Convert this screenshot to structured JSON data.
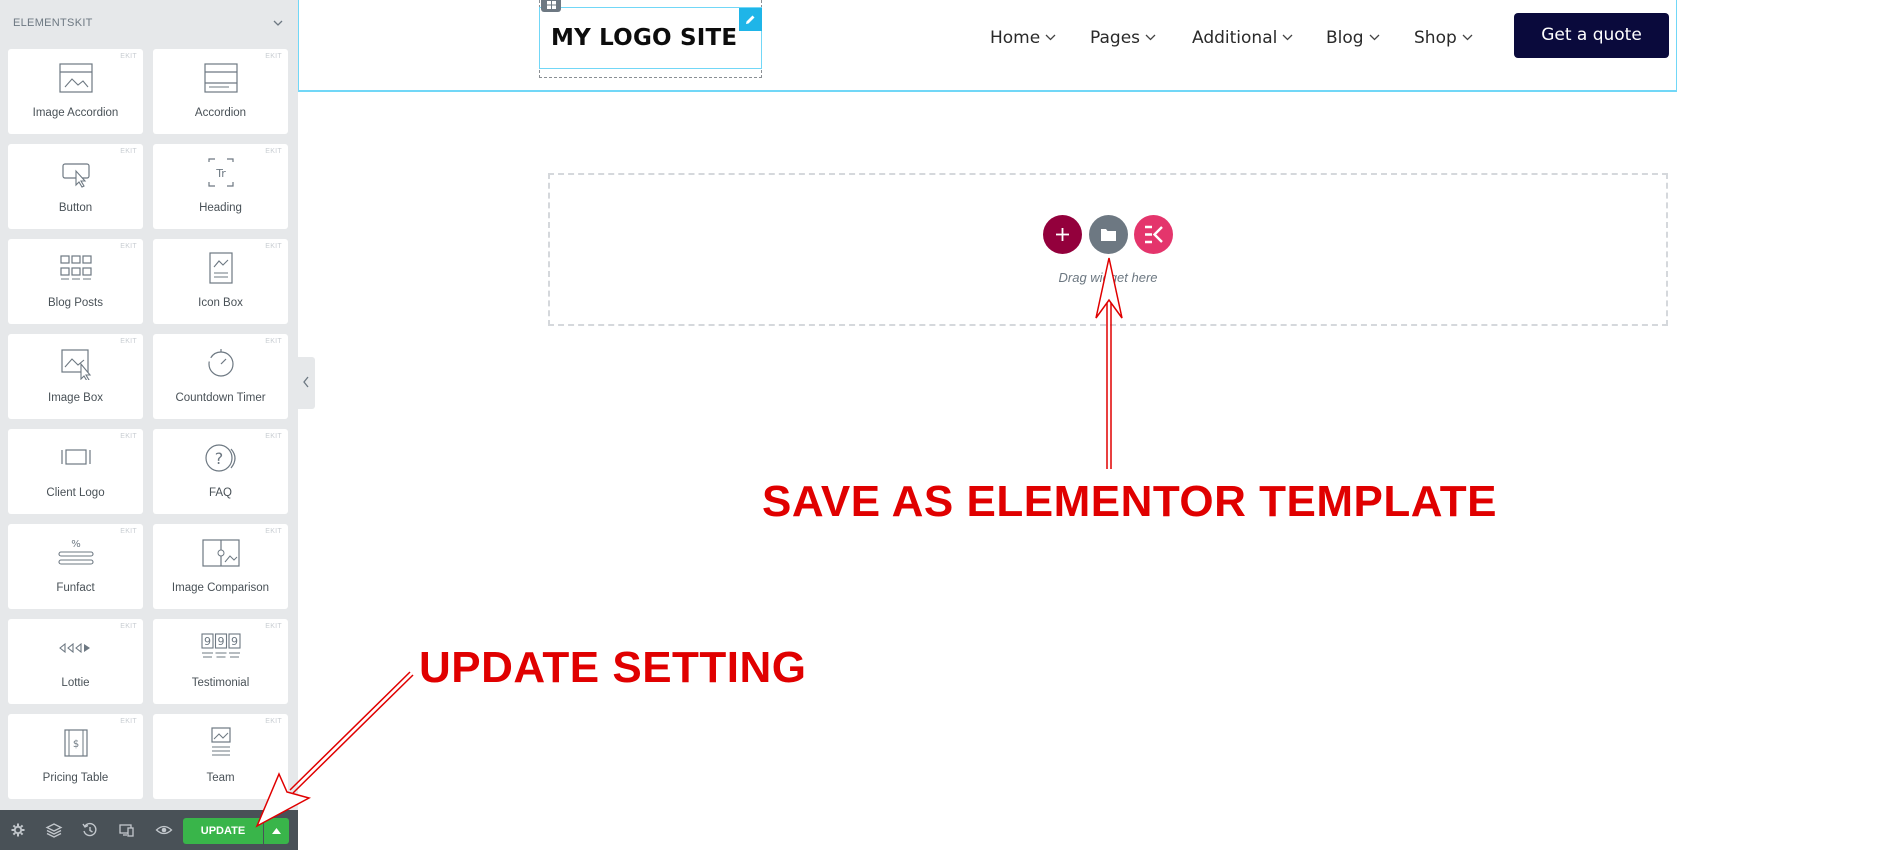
{
  "sidebar": {
    "title": "ELEMENTSKIT",
    "widgets": [
      {
        "label": "Image Accordion",
        "badge": "EKIT",
        "icon": "image-accordion-icon"
      },
      {
        "label": "Accordion",
        "badge": "EKIT",
        "icon": "accordion-icon"
      },
      {
        "label": "Button",
        "badge": "EKIT",
        "icon": "button-icon"
      },
      {
        "label": "Heading",
        "badge": "EKIT",
        "icon": "heading-icon"
      },
      {
        "label": "Blog Posts",
        "badge": "EKIT",
        "icon": "blog-posts-icon"
      },
      {
        "label": "Icon Box",
        "badge": "EKIT",
        "icon": "icon-box-icon"
      },
      {
        "label": "Image Box",
        "badge": "EKIT",
        "icon": "image-box-icon"
      },
      {
        "label": "Countdown Timer",
        "badge": "EKIT",
        "icon": "countdown-timer-icon"
      },
      {
        "label": "Client Logo",
        "badge": "EKIT",
        "icon": "client-logo-icon"
      },
      {
        "label": "FAQ",
        "badge": "EKIT",
        "icon": "faq-icon"
      },
      {
        "label": "Funfact",
        "badge": "EKIT",
        "icon": "funfact-icon"
      },
      {
        "label": "Image Comparison",
        "badge": "EKIT",
        "icon": "image-comparison-icon"
      },
      {
        "label": "Lottie",
        "badge": "EKIT",
        "icon": "lottie-icon"
      },
      {
        "label": "Testimonial",
        "badge": "EKIT",
        "icon": "testimonial-icon"
      },
      {
        "label": "Pricing Table",
        "badge": "EKIT",
        "icon": "pricing-table-icon"
      },
      {
        "label": "Team",
        "badge": "EKIT",
        "icon": "team-icon"
      }
    ],
    "footer": {
      "update_label": "UPDATE",
      "icons": [
        "settings-icon",
        "navigator-icon",
        "history-icon",
        "responsive-icon",
        "preview-icon"
      ]
    }
  },
  "header": {
    "logo_text": "MY LOGO SITE",
    "nav": [
      "Home",
      "Pages",
      "Additional",
      "Blog",
      "Shop"
    ],
    "cta_label": "Get a quote"
  },
  "dropzone": {
    "drag_text": "Drag widget here"
  },
  "annotations": {
    "template": "SAVE AS ELEMENTOR TEMPLATE",
    "update": "UPDATE SETTING",
    "color": "#e00000"
  },
  "colors": {
    "sidebar_bg": "#e6e8ea",
    "update_green": "#39b54a",
    "cta_navy": "#0a0a3c",
    "add_maroon": "#93003c",
    "ek_pink": "#e4356c",
    "selection_cyan": "#71d7f7"
  }
}
